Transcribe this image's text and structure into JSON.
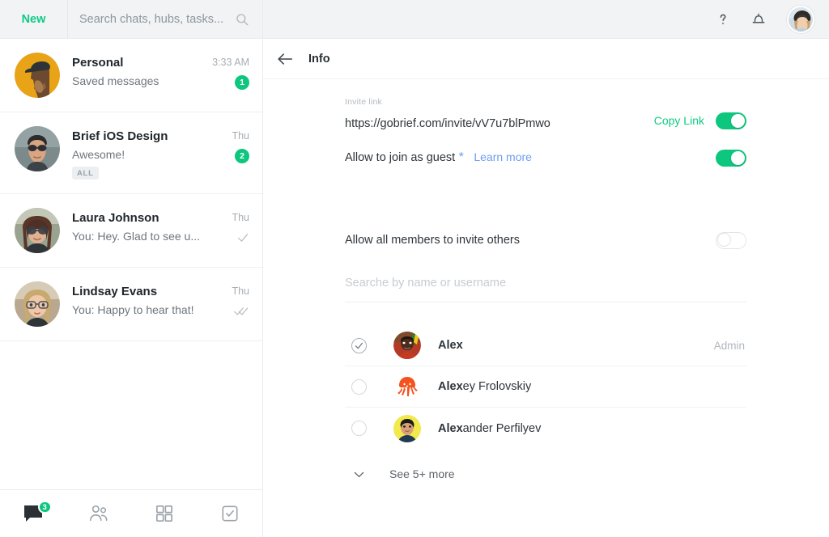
{
  "left": {
    "new_label": "New",
    "search_placeholder": "Search chats, hubs, tasks...",
    "search_value": "",
    "search_icon": "search-icon",
    "chats": [
      {
        "title": "Personal",
        "preview": "Saved messages",
        "time": "3:33 AM",
        "badge": "1",
        "tag": "",
        "ticks": ""
      },
      {
        "title": "Brief iOS Design",
        "preview": "Awesome!",
        "time": "Thu",
        "badge": "2",
        "tag": "ALL",
        "ticks": ""
      },
      {
        "title": "Laura Johnson",
        "preview": "You: Hey. Glad to see u...",
        "time": "Thu",
        "badge": "",
        "tag": "",
        "ticks": "single-check"
      },
      {
        "title": "Lindsay Evans",
        "preview": "You: Happy to hear that!",
        "time": "Thu",
        "badge": "",
        "tag": "",
        "ticks": "double-check"
      }
    ],
    "nav": [
      {
        "name": "chats",
        "icon": "chat-bubble-icon",
        "badge": "3",
        "active": true
      },
      {
        "name": "contacts",
        "icon": "people-icon",
        "badge": "",
        "active": false
      },
      {
        "name": "apps",
        "icon": "grid-icon",
        "badge": "",
        "active": false
      },
      {
        "name": "tasks",
        "icon": "checkbox-icon",
        "badge": "",
        "active": false
      }
    ]
  },
  "topbar": {
    "help_icon": "question-mark-icon",
    "notifications_icon": "bell-icon",
    "avatar": "user-avatar"
  },
  "info": {
    "back_icon": "back-arrow-icon",
    "title": "Info",
    "invite_label": "Invite link",
    "invite_url": "https://gobrief.com/invite/vV7u7blPmwo",
    "copy_link_label": "Copy Link",
    "invite_toggle_on": true,
    "guest_label": "Allow to join as guest",
    "guest_star": "*",
    "learn_more_label": "Learn more",
    "guest_toggle_on": true,
    "members_invite_label": "Allow all members to invite others",
    "members_invite_toggle_on": false,
    "member_search_placeholder": "Searche by name or username",
    "member_search_value": "",
    "members": [
      {
        "match": "Alex",
        "rest": "",
        "role": "Admin",
        "checked": true
      },
      {
        "match": "Alex",
        "rest": "ey Frolovskiy",
        "role": "",
        "checked": false
      },
      {
        "match": "Alex",
        "rest": "ander Perfilyev",
        "role": "",
        "checked": false
      }
    ],
    "see_more_label": "See 5+ more",
    "see_more_icon": "chevron-down-icon"
  },
  "colors": {
    "accent_green": "#0ec77f",
    "link_blue": "#6c9ef0",
    "panel_gray": "#f1f3f5",
    "text_dark": "#2d343a",
    "text_muted": "#a7aeb4"
  }
}
